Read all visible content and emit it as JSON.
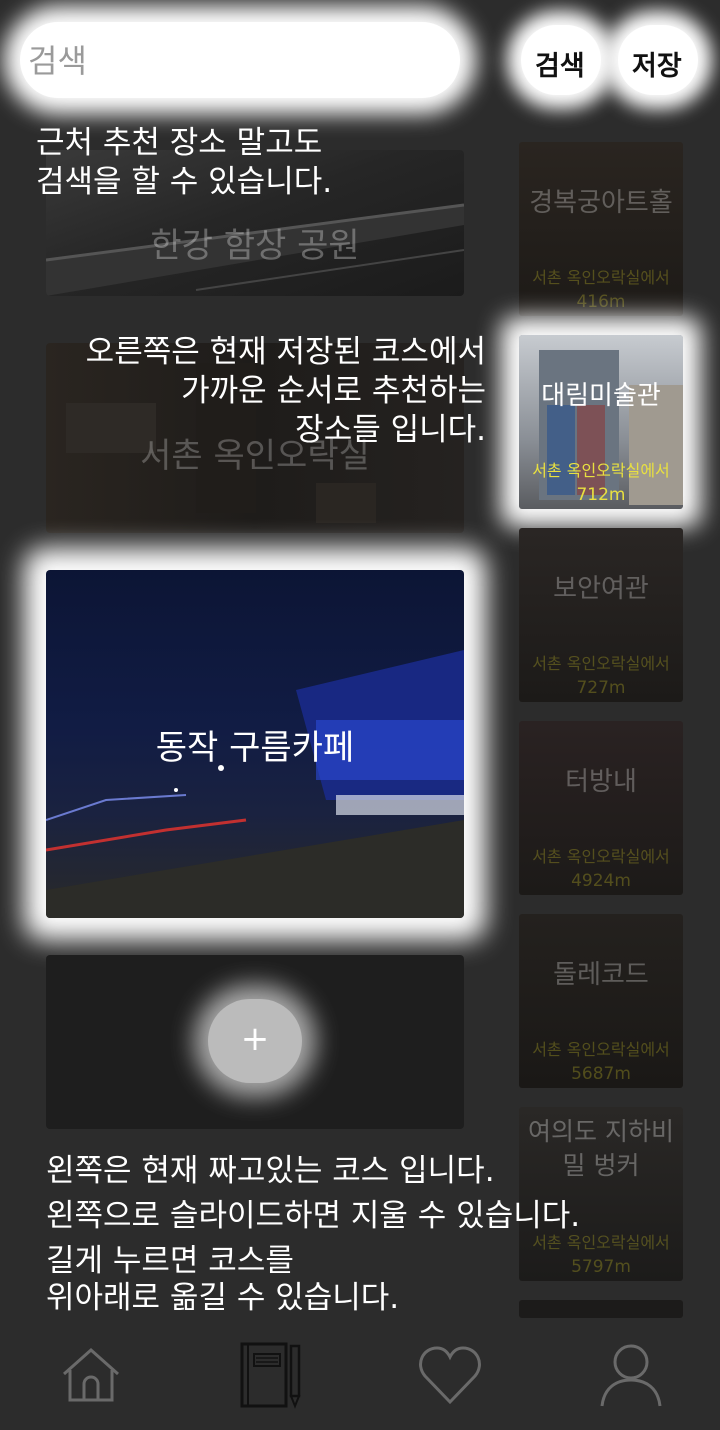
{
  "search": {
    "placeholder": "검색",
    "search_button": "검색",
    "save_button": "저장"
  },
  "course_cards": [
    {
      "title": "한강 함상 공원"
    },
    {
      "title": "서촌 옥인오락실"
    },
    {
      "title": "동작 구름카페"
    }
  ],
  "add_button": "+",
  "recommendations": [
    {
      "name": "경복궁아트홀",
      "from": "서촌 옥인오락실에서",
      "distance": "416m"
    },
    {
      "name": "대림미술관",
      "from": "서촌 옥인오락실에서",
      "distance": "712m"
    },
    {
      "name": "보안여관",
      "from": "서촌 옥인오락실에서",
      "distance": "727m"
    },
    {
      "name": "터방내",
      "from": "서촌 옥인오락실에서",
      "distance": "4924m"
    },
    {
      "name": "돌레코드",
      "from": "서촌 옥인오락실에서",
      "distance": "5687m"
    },
    {
      "name": "여의도 지하비밀 벙커",
      "from": "서촌 옥인오락실에서",
      "distance": "5797m"
    }
  ],
  "hints": {
    "top": [
      "근처 추천 장소 말고도",
      "검색을 할 수 있습니다."
    ],
    "right": [
      "오른쪽은 현재 저장된 코스에서",
      "가까운 순서로 추천하는",
      "장소들 입니다."
    ],
    "bottom": [
      "왼쪽은 현재 짜고있는 코스 입니다.",
      "왼쪽으로 슬라이드하면 지울 수 있습니다.",
      "길게 누르면 코스를",
      "위아래로 옮길 수 있습니다."
    ]
  },
  "nav_icons": [
    "home-icon",
    "notebook-icon",
    "heart-icon",
    "user-icon"
  ]
}
